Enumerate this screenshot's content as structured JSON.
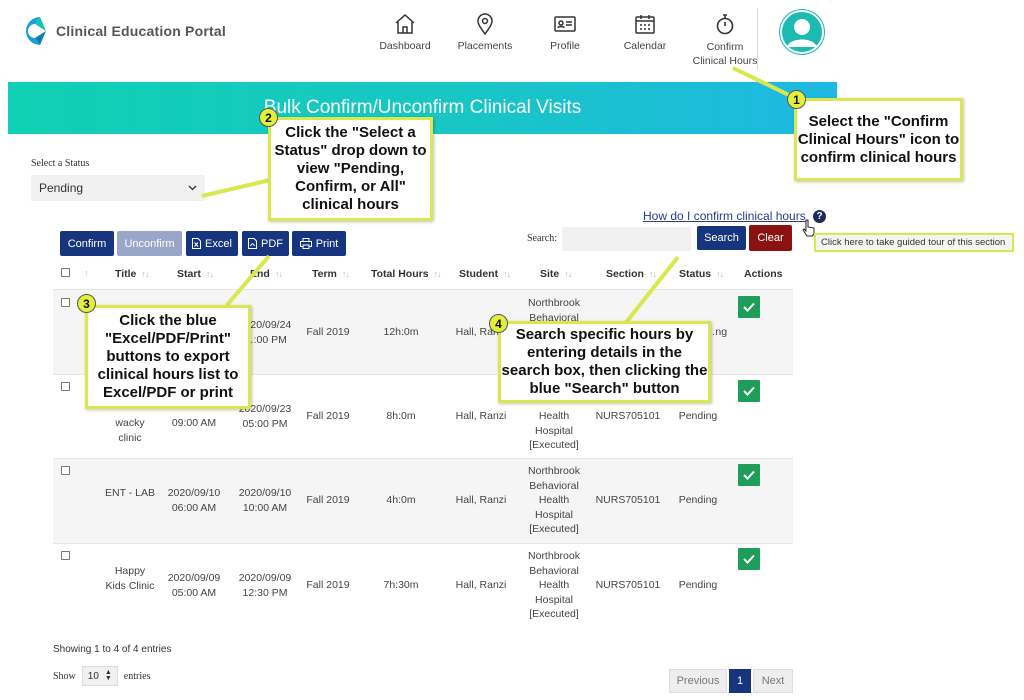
{
  "header": {
    "app_title": "Clinical Education Portal",
    "nav": [
      {
        "label": "Dashboard",
        "icon": "home-icon"
      },
      {
        "label": "Placements",
        "icon": "map-pin-icon"
      },
      {
        "label": "Profile",
        "icon": "id-card-icon"
      },
      {
        "label": "Calendar",
        "icon": "calendar-icon"
      },
      {
        "label": "Confirm Clinical Hours",
        "label_line1": "Confirm",
        "label_line2": "Clinical Hours",
        "icon": "stopwatch-icon"
      }
    ],
    "avatar_icon": "user-avatar-icon"
  },
  "banner": {
    "title": "Bulk Confirm/Unconfirm Clinical Visits"
  },
  "status_filter": {
    "label": "Select a Status",
    "value": "Pending"
  },
  "help": {
    "link_text": "How do I confirm clinical hours",
    "tooltip": "Click here to take guided tour of this section"
  },
  "toolbar": {
    "confirm": "Confirm",
    "unconfirm": "Unconfirm",
    "excel": "Excel",
    "pdf": "PDF",
    "print": "Print",
    "search_label": "Search:",
    "search_value": "",
    "search_button": "Search",
    "clear_button": "Clear"
  },
  "table": {
    "headers": [
      "Title",
      "Start",
      "End",
      "Term",
      "Total Hours",
      "Student",
      "Site",
      "Section",
      "Status",
      "Actions"
    ],
    "rows": [
      {
        "title": "",
        "start": "",
        "end": "2020/09/24",
        "end2": "…:00 PM",
        "term": "Fall 2019",
        "hours": "12h:0m",
        "student": "Hall, Ranzi",
        "site": [
          "Northbrook",
          "Behavioral"
        ],
        "section": "",
        "status": "…ng"
      },
      {
        "title": "wacky clinic",
        "start": "09:00 AM",
        "end": "2020/09/23",
        "end2": "05:00 PM",
        "term": "Fall 2019",
        "hours": "8h:0m",
        "student": "Hall, Ranzi",
        "site": [
          "Health",
          "Hospital",
          "[Executed]"
        ],
        "section": "NURS705101",
        "status": "Pending"
      },
      {
        "title": "ENT - LAB",
        "start": "2020/09/10",
        "start2": "06:00 AM",
        "end": "2020/09/10",
        "end2": "10:00 AM",
        "term": "Fall 2019",
        "hours": "4h:0m",
        "student": "Hall, Ranzi",
        "site": [
          "Northbrook",
          "Behavioral",
          "Health",
          "Hospital",
          "[Executed]"
        ],
        "section": "NURS705101",
        "status": "Pending"
      },
      {
        "title": "Happy Kids Clinic",
        "start": "2020/09/09",
        "start2": "05:00 AM",
        "end": "2020/09/09",
        "end2": "12:30 PM",
        "term": "Fall 2019",
        "hours": "7h:30m",
        "student": "Hall, Ranzi",
        "site": [
          "Northbrook",
          "Behavioral",
          "Health",
          "Hospital",
          "[Executed]"
        ],
        "section": "NURS705101",
        "status": "Pending"
      }
    ]
  },
  "footer": {
    "info": "Showing 1 to 4 of 4 entries",
    "show_label": "Show",
    "page_length": "10",
    "entries_label": "entries",
    "previous": "Previous",
    "current_page": "1",
    "next": "Next"
  },
  "callouts": [
    {
      "number": "1",
      "text": "Select the \"Confirm Clinical Hours\" icon to confirm clinical hours"
    },
    {
      "number": "2",
      "text": "Click the \"Select a Status\" drop down to view \"Pending, Confirm, or All\" clinical hours"
    },
    {
      "number": "3",
      "text": "Click the blue \"Excel/PDF/Print\" buttons to export clinical hours list to Excel/PDF or print"
    },
    {
      "number": "4",
      "text": "Search specific hours by entering details in the search box, then clicking the blue \"Search\" button"
    }
  ],
  "colors": {
    "navy": "#17357f",
    "banner_start": "#0fd0b3",
    "banner_end": "#1eb8e3",
    "callout_border": "#d8e84e",
    "check_green": "#1e9e58",
    "clear_red": "#8c1212"
  }
}
